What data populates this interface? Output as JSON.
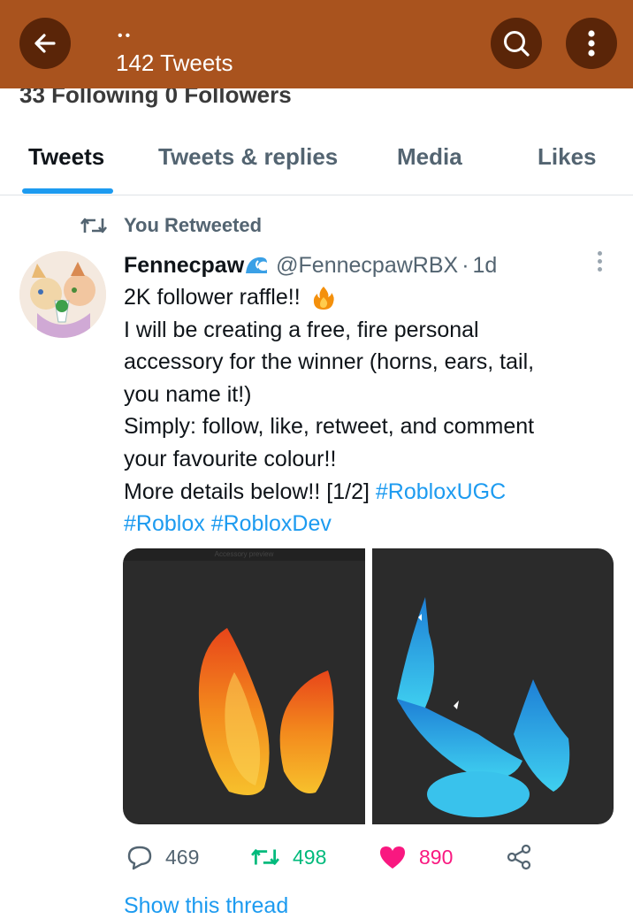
{
  "header": {
    "dots": "••",
    "tweet_count": "142 Tweets"
  },
  "profile_strip": {
    "text": "33 Following   0 Followers"
  },
  "tabs": [
    {
      "label": "Tweets",
      "active": true
    },
    {
      "label": "Tweets & replies",
      "active": false
    },
    {
      "label": "Media",
      "active": false
    },
    {
      "label": "Likes",
      "active": false
    }
  ],
  "tweet": {
    "retweet_label": "You Retweeted",
    "author_name": "Fennecpaw",
    "author_handle": "@FennecpawRBX",
    "separator": "·",
    "time": "1d",
    "lines": [
      "2K follower raffle!!",
      "I will be creating a free, fire personal",
      "accessory for the winner (horns, ears, tail,",
      "you name it!)",
      "Simply: follow, like, retweet, and comment",
      "your favourite colour!!"
    ],
    "details_text": "More details below!! [1/2]",
    "hashtags": [
      "#RobloxUGC",
      "#Roblox",
      "#RobloxDev"
    ],
    "media_caption": "Accessory preview",
    "actions": {
      "replies": "469",
      "retweets": "498",
      "likes": "890"
    },
    "show_thread": "Show this thread"
  },
  "colors": {
    "header_bg": "#a9531e",
    "header_button": "#5a2508",
    "accent": "#1d9bf0",
    "retweet_green": "#00ba7c",
    "like_pink": "#f91880"
  }
}
